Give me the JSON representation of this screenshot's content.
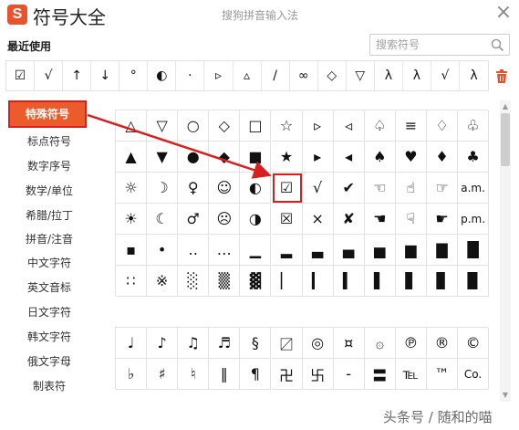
{
  "window": {
    "logo_letter": "S",
    "title": "符号大全",
    "subtitle": "搜狗拼音输入法",
    "close_glyph": "×"
  },
  "recent": {
    "label": "最近使用",
    "symbols": [
      "☑",
      "√",
      "↑",
      "↓",
      "°",
      "◐",
      "·",
      "▹",
      "▵",
      "/",
      "∞",
      "◇",
      "▽",
      "λ",
      "λ",
      "√",
      "λ"
    ]
  },
  "search": {
    "placeholder": "搜索符号",
    "value": ""
  },
  "sidebar": {
    "items": [
      {
        "label": "特殊符号",
        "active": true
      },
      {
        "label": "标点符号"
      },
      {
        "label": "数字序号"
      },
      {
        "label": "数学/单位"
      },
      {
        "label": "希腊/拉丁"
      },
      {
        "label": "拼音/注音"
      },
      {
        "label": "中文字符"
      },
      {
        "label": "英文音标"
      },
      {
        "label": "日文字符"
      },
      {
        "label": "韩文字符"
      },
      {
        "label": "俄文字母"
      },
      {
        "label": "制表符"
      }
    ]
  },
  "grid_special": [
    [
      "△",
      "▽",
      "○",
      "◇",
      "□",
      "☆",
      "▹",
      "◃",
      "♤",
      "≡",
      "♢",
      "♧"
    ],
    [
      "▲",
      "▼",
      "●",
      "◆",
      "■",
      "★",
      "▸",
      "◂",
      "♠",
      "♥",
      "♦",
      "♣"
    ],
    [
      "☼",
      "☽",
      "♀",
      "☺",
      "◐",
      "☑",
      "√",
      "✔",
      "☜",
      "☝",
      "☞",
      "a.m."
    ],
    [
      "☀",
      "☾",
      "♂",
      "☹",
      "◑",
      "☒",
      "×",
      "✘",
      "☚",
      "☟",
      "☛",
      "p.m."
    ],
    [
      "▪",
      "•",
      "‥",
      "…",
      "▁",
      "▂",
      "▃",
      "▄",
      "▅",
      "▆",
      "▇",
      "█"
    ],
    [
      "∷",
      "※",
      "░",
      "▒",
      "▓",
      "▏",
      "▎",
      "▍",
      "▌",
      "▋",
      "▊",
      "▉"
    ]
  ],
  "grid_music": [
    [
      "♩",
      "♪",
      "♫",
      "♬",
      "§",
      "〼",
      "◎",
      "¤",
      "۞",
      "℗",
      "®",
      "©"
    ],
    [
      "♭",
      "♯",
      "♮",
      "‖",
      "¶",
      "卍",
      "卐",
      "‐",
      "〓",
      "℡",
      "™",
      "Co."
    ]
  ],
  "highlighted_symbol": "☑",
  "colors": {
    "accent": "#ec5b2c",
    "highlight_red": "#d81f1f"
  },
  "watermark": "头条号 / 随和的喵"
}
